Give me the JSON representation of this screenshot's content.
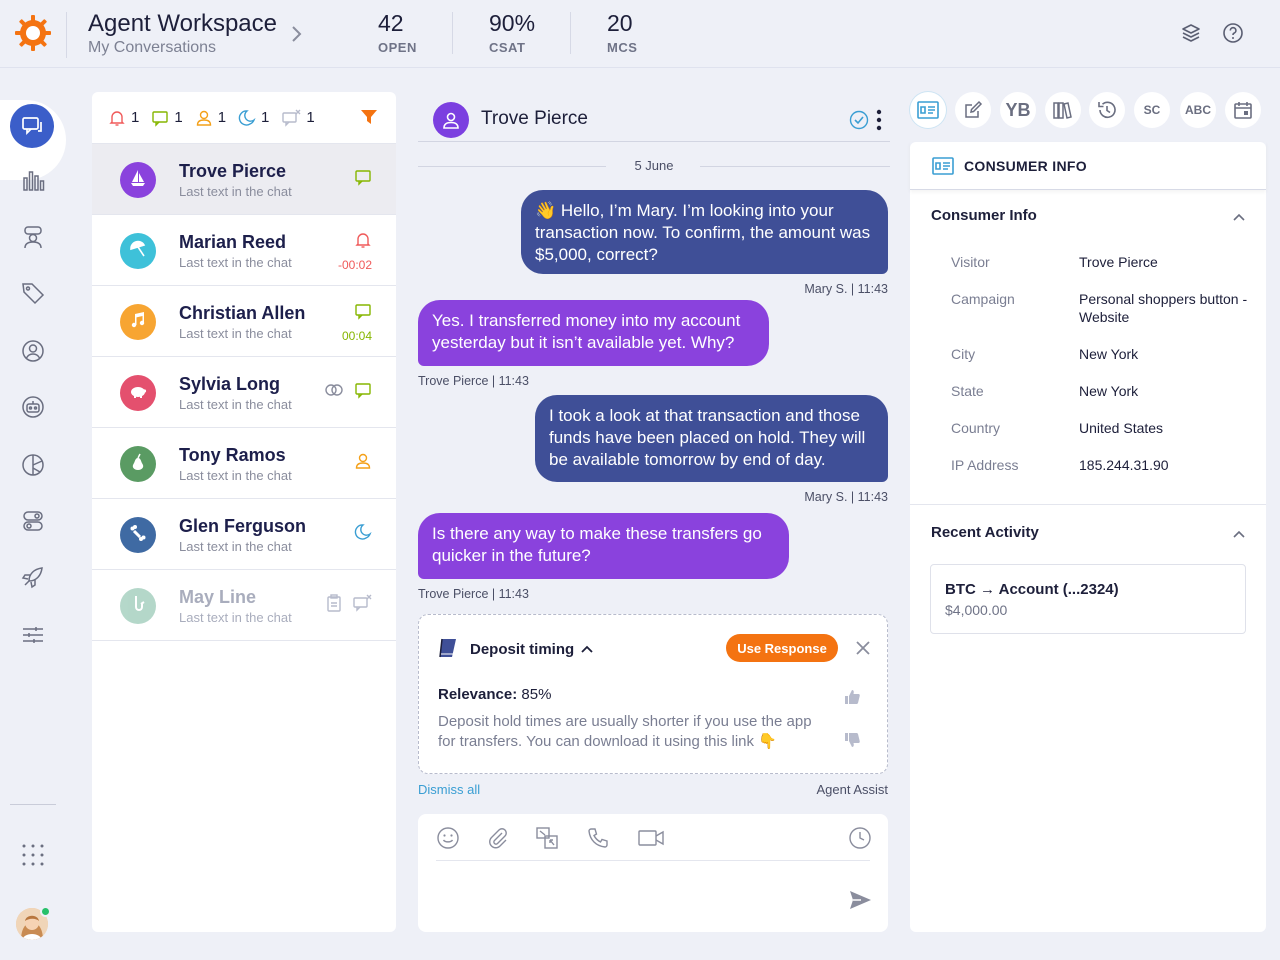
{
  "header": {
    "title": "Agent Workspace",
    "subtitle": "My Conversations",
    "stats": [
      {
        "value": "42",
        "label": "OPEN"
      },
      {
        "value": "90%",
        "label": "CSAT"
      },
      {
        "value": "20",
        "label": "MCS"
      }
    ],
    "icons": [
      "layers-icon",
      "help-icon"
    ]
  },
  "nav": {
    "items": [
      "conversations-icon",
      "analytics-icon",
      "agent-icon",
      "tag-icon",
      "user-icon",
      "bot-icon",
      "pie-chart-icon",
      "toggle-icon",
      "rocket-icon",
      "sliders-icon"
    ],
    "apps_icon": "apps-grid-icon"
  },
  "filters": [
    {
      "icon": "bell-icon",
      "count": "1",
      "color": "#f05a5a"
    },
    {
      "icon": "chat-icon",
      "count": "1",
      "color": "#86b600"
    },
    {
      "icon": "person-icon",
      "count": "1",
      "color": "#f4a018"
    },
    {
      "icon": "moon-icon",
      "count": "1",
      "color": "#3a9ed3"
    },
    {
      "icon": "muted-chat-icon",
      "count": "1",
      "color": "#b7bbcc"
    }
  ],
  "conversations": [
    {
      "name": "Trove Pierce",
      "last": "Last text in the chat",
      "avatar_color": "#8a42dd",
      "avatar_icon": "sailboat-icon",
      "status_icon": "chat-icon",
      "status_color": "#86b600",
      "timer": "",
      "selected": true
    },
    {
      "name": "Marian Reed",
      "last": "Last text in the chat",
      "avatar_color": "#3ec1d9",
      "avatar_icon": "umbrella-icon",
      "status_icon": "bell-icon",
      "status_color": "#f05a5a",
      "timer": "-00:02",
      "timer_color": "#f05a5a"
    },
    {
      "name": "Christian Allen",
      "last": "Last text in the chat",
      "avatar_color": "#f7a532",
      "avatar_icon": "music-icon",
      "status_icon": "chat-icon",
      "status_color": "#86b600",
      "timer": "00:04",
      "timer_color": "#86b600"
    },
    {
      "name": "Sylvia Long",
      "last": "Last text in the chat",
      "avatar_color": "#e4506e",
      "avatar_icon": "piggy-icon",
      "status_icon": "chat-icon",
      "status_color": "#86b600",
      "timer": ""
    },
    {
      "name": "Tony Ramos",
      "last": "Last text in the chat",
      "avatar_color": "#5a9b63",
      "avatar_icon": "pear-icon",
      "status_icon": "person-icon",
      "status_color": "#f4a018",
      "timer": ""
    },
    {
      "name": "Glen Ferguson",
      "last": "Last text in the chat",
      "avatar_color": "#3f6aa3",
      "avatar_icon": "bone-icon",
      "status_icon": "moon-icon",
      "status_color": "#3a9ed3",
      "timer": ""
    },
    {
      "name": "May Line",
      "last": "Last text in the chat",
      "avatar_color": "#5aa88a",
      "avatar_icon": "saxophone-icon",
      "status_icon": "muted-chat-icon",
      "status_color": "#b7bbcc",
      "timer": "",
      "faded": true
    }
  ],
  "chat": {
    "name": "Trove Pierce",
    "date": "5 June",
    "messages": [
      {
        "from": "agent",
        "text": "👋 Hello, I’m Mary. I’m looking into your transaction now. To confirm, the amount was $5,000, correct?",
        "meta": "Mary  S. |  11:43"
      },
      {
        "from": "visitor",
        "text": "Yes. I transferred money into my account yesterday but it isn’t available yet. Why?",
        "meta": "Trove Pierce  |  11:43"
      },
      {
        "from": "agent",
        "text": "I took a look at that transaction and those funds have been placed on hold. They will be available tomorrow by end of day.",
        "meta": "Mary  S. |  11:43"
      },
      {
        "from": "visitor",
        "text": "Is there any way to make these transfers go quicker in the future?",
        "meta": "Trove Pierce  |  11:43"
      }
    ]
  },
  "assist": {
    "title": "Deposit timing",
    "use_label": "Use Response",
    "relevance_label": "Relevance:",
    "relevance_value": "85%",
    "text": "Deposit hold times are usually shorter if you use the app for transfers. You can download it using this link 👇",
    "dismiss": "Dismiss all",
    "label": "Agent Assist"
  },
  "composer": {
    "placeholder": "",
    "icons": [
      "emoji-icon",
      "attach-icon",
      "cobrowse-icon",
      "phone-icon",
      "video-icon",
      "clock-icon",
      "send-icon"
    ]
  },
  "right": {
    "tools": [
      {
        "icon": "id-card-icon",
        "text": ""
      },
      {
        "icon": "edit-icon",
        "text": ""
      },
      {
        "icon": "yb-icon",
        "text": "YB"
      },
      {
        "icon": "library-icon",
        "text": ""
      },
      {
        "icon": "history-icon",
        "text": ""
      },
      {
        "icon": "sc-icon",
        "text": "SC"
      },
      {
        "icon": "abc-icon",
        "text": "ABC"
      },
      {
        "icon": "calendar-icon",
        "text": ""
      }
    ],
    "panel_title": "CONSUMER INFO",
    "info_title": "Consumer Info",
    "info": [
      {
        "label": "Visitor",
        "value": "Trove Pierce"
      },
      {
        "label": "Campaign",
        "value": "Personal shoppers button - Website"
      },
      {
        "label": "City",
        "value": "New York"
      },
      {
        "label": "State",
        "value": "New York"
      },
      {
        "label": "Country",
        "value": "United States"
      },
      {
        "label": "IP Address",
        "value": "185.244.31.90"
      }
    ],
    "activity_title": "Recent Activity",
    "activity": {
      "title": "BTC → Account  (...2324)",
      "amount": "$4,000.00"
    }
  },
  "colors": {
    "accent": "#3b5ec9",
    "visitor_bubble": "#8a42dd",
    "agent_bubble": "#3f4f97",
    "cta": "#f47311"
  }
}
